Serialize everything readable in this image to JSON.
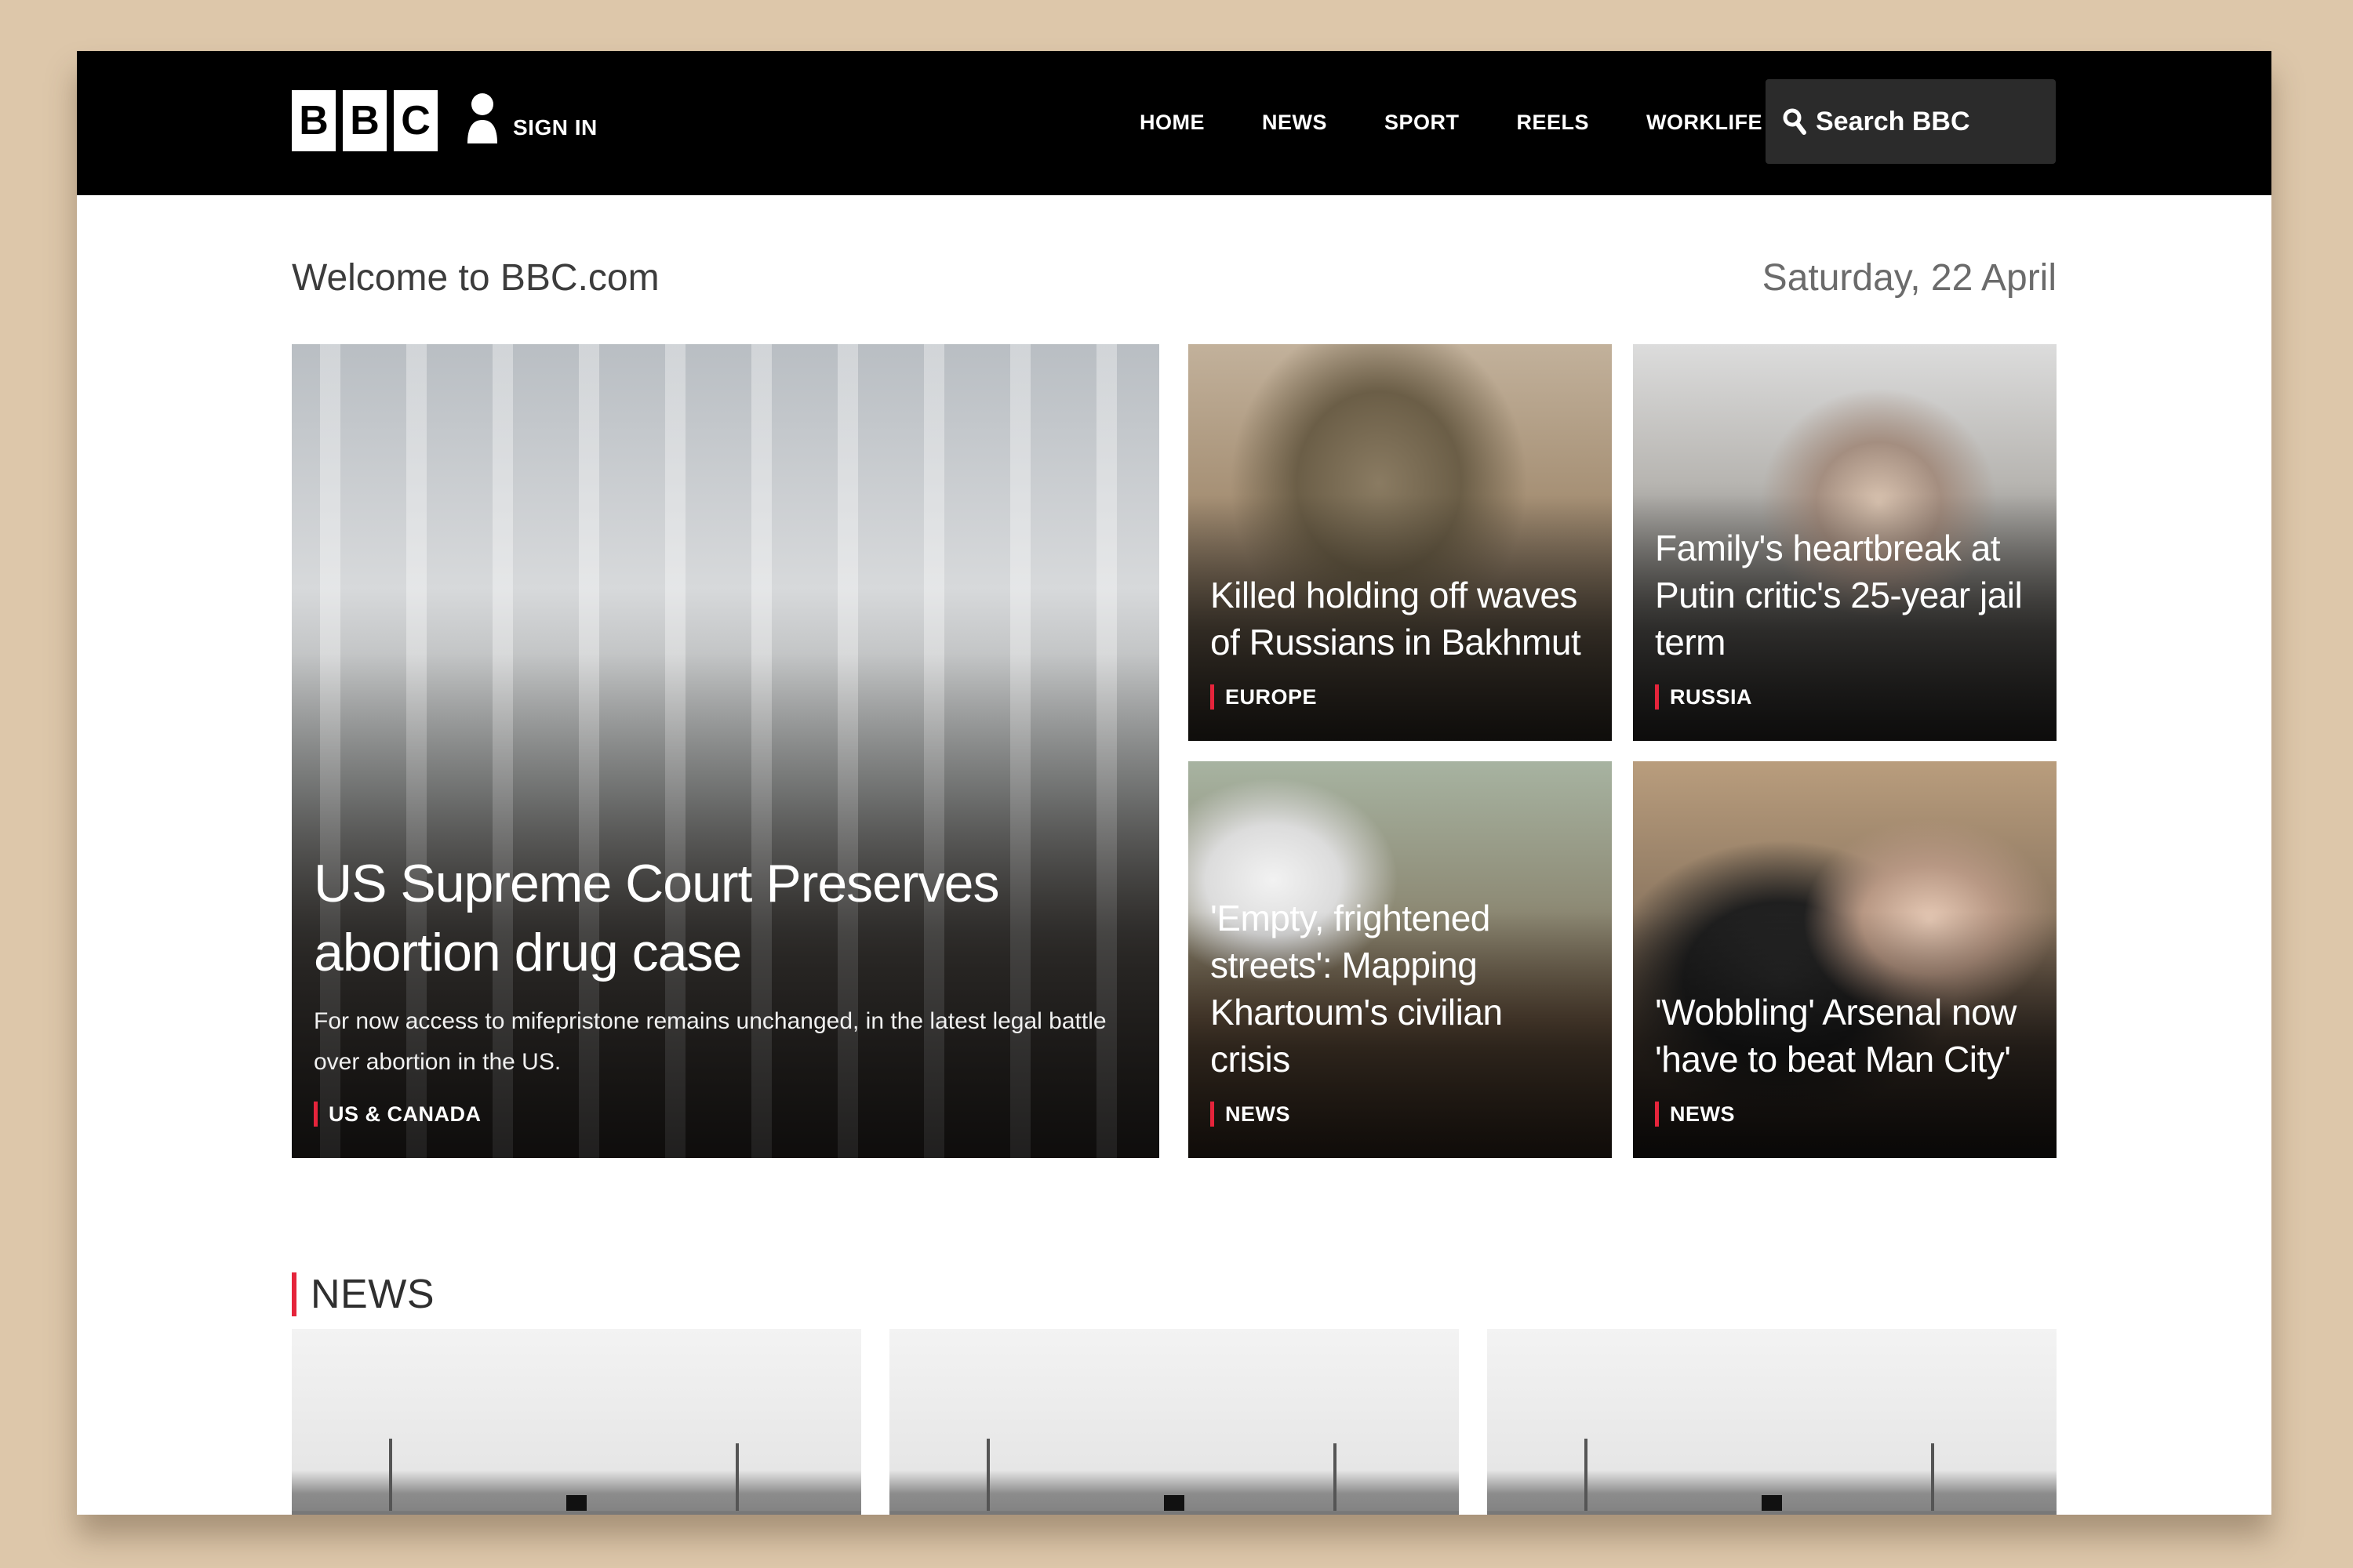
{
  "header": {
    "logo_letters": [
      "B",
      "B",
      "C"
    ],
    "signin_label": "SIGN IN",
    "nav": [
      "HOME",
      "NEWS",
      "SPORT",
      "REELS",
      "WORKLIFE"
    ],
    "search_label": "Search BBC"
  },
  "welcome": "Welcome to BBC.com",
  "date": "Saturday, 22 April",
  "accent_color": "#e5243b",
  "featured": {
    "headline": "US Supreme Court Preserves abortion drug case",
    "summary": "For now access to mifepristone remains unchanged, in the latest legal battle over abortion in the US.",
    "tag": "US & CANADA"
  },
  "stories": [
    {
      "headline": "Killed holding off waves of Russians in Bakhmut",
      "tag": "EUROPE"
    },
    {
      "headline": "Family's heartbreak at Putin critic's 25-year jail term",
      "tag": "RUSSIA"
    },
    {
      "headline": "'Empty, frightened streets': Mapping Khartoum's civilian crisis",
      "tag": "NEWS"
    },
    {
      "headline": "'Wobbling' Arsenal now 'have to beat Man City'",
      "tag": "NEWS"
    }
  ],
  "news_section": {
    "title": "NEWS"
  }
}
